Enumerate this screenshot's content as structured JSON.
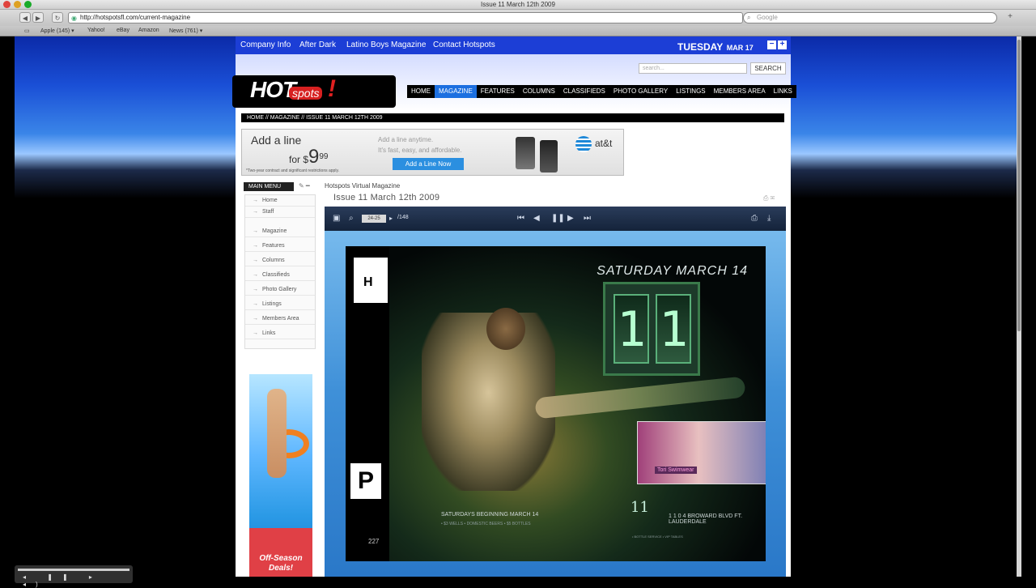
{
  "browser": {
    "window_title": "Issue 11 March 12th 2009",
    "url": "http://hotspotsfl.com/current-magazine",
    "search_placeholder": "Google",
    "bookmarks": [
      "Apple (145) ▾",
      "Yahoo!",
      "eBay",
      "Amazon",
      "News (761) ▾"
    ]
  },
  "topnav": {
    "links": [
      "Company Info",
      "After Dark",
      "Latino Boys Magazine",
      "Contact Hotspots"
    ],
    "day": "TUESDAY",
    "date": "MAR 17",
    "controls": [
      "−",
      "+"
    ]
  },
  "header": {
    "search_placeholder": "search...",
    "search_button": "SEARCH",
    "logo_hot": "HOT",
    "logo_spots": "spots",
    "logo_bang": "!",
    "nav": [
      "HOME",
      "MAGAZINE",
      "FEATURES",
      "COLUMNS",
      "CLASSIFIEDS",
      "PHOTO GALLERY",
      "LISTINGS",
      "MEMBERS AREA",
      "LINKS"
    ],
    "active_nav": "MAGAZINE"
  },
  "breadcrumb": "HOME // MAGAZINE // ISSUE 11 MARCH 12TH 2009",
  "ad": {
    "line1": "Add a line",
    "for": "for $",
    "price": "9",
    "cents": "99",
    "fine": "*Two-year contract and significant restrictions apply.",
    "tagline1": "Add a line anytime.",
    "tagline2": "It's fast, easy, and affordable.",
    "cta": "Add a Line Now",
    "brand": "at&t"
  },
  "sidebar": {
    "title": "MAIN MENU",
    "tools": "✎ ━",
    "items": [
      "Home",
      "Staff",
      "Magazine",
      "Features",
      "Columns",
      "Classifieds",
      "Photo Gallery",
      "Listings",
      "Members Area",
      "Links"
    ],
    "promo_text": "Off-Season Deals!"
  },
  "magazine": {
    "section": "Hotspots Virtual Magazine",
    "title": "Issue 11 March 12th 2009",
    "page_indicator": "24-25",
    "total_pages": "/148",
    "cover_date": "SATURDAY MARCH 14",
    "cover_number": [
      "1",
      "1"
    ],
    "cover_sub": "SATURDAYS BEGINNING MARCH 14",
    "cover_sub_small": "• $3 WELLS • DOMESTIC BEERS • $5 BOTTLES",
    "cover_logo": "11",
    "cover_address": "1 1 0 4 BROWARD BLVD FT. LAUDERDALE",
    "cover_address_small": "• BOTTLE SERVICE • VIP TABLES",
    "inset_tag": "Tori Swimwear",
    "left_logo": "H",
    "left_p": "P",
    "left_num": "227"
  }
}
